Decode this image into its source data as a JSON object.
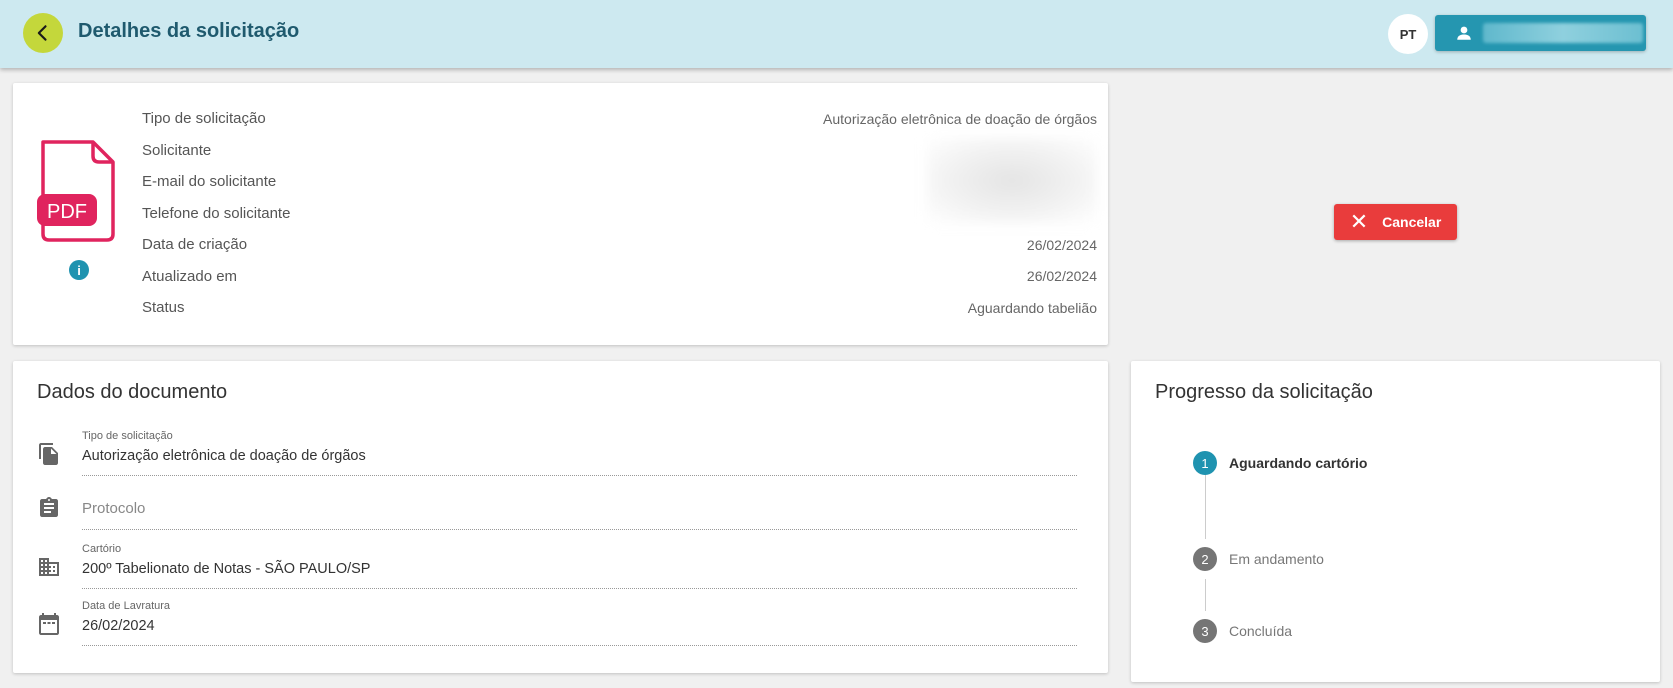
{
  "header": {
    "title": "Detalhes da solicitação",
    "language": "PT"
  },
  "summary": {
    "rows": [
      {
        "label": "Tipo de solicitação",
        "value": "Autorização eletrônica de doação de órgãos"
      },
      {
        "label": "Solicitante",
        "value": ""
      },
      {
        "label": "E-mail do solicitante",
        "value": ""
      },
      {
        "label": "Telefone do solicitante",
        "value": ""
      },
      {
        "label": "Data de criação",
        "value": "26/02/2024"
      },
      {
        "label": "Atualizado em",
        "value": "26/02/2024"
      },
      {
        "label": "Status",
        "value": "Aguardando tabelião"
      }
    ],
    "file_badge": "PDF"
  },
  "actions": {
    "cancel_label": "Cancelar"
  },
  "document": {
    "title": "Dados do documento",
    "fields": [
      {
        "label": "Tipo de solicitação",
        "value": "Autorização eletrônica de doação de órgãos"
      },
      {
        "label": "",
        "value": "",
        "placeholder": "Protocolo"
      },
      {
        "label": "Cartório",
        "value": "200º Tabelionato de Notas  - SÃO PAULO/SP"
      },
      {
        "label": "Data de Lavratura",
        "value": "26/02/2024"
      }
    ]
  },
  "progress": {
    "title": "Progresso da solicitação",
    "steps": [
      {
        "number": "1",
        "label": "Aguardando cartório"
      },
      {
        "number": "2",
        "label": "Em andamento"
      },
      {
        "number": "3",
        "label": "Concluída"
      }
    ]
  },
  "colors": {
    "header_bg": "#cde9f0",
    "back_button": "#c4d73b",
    "primary": "#2596b0",
    "danger": "#e93c3c",
    "pdf_accent": "#e0245e"
  }
}
